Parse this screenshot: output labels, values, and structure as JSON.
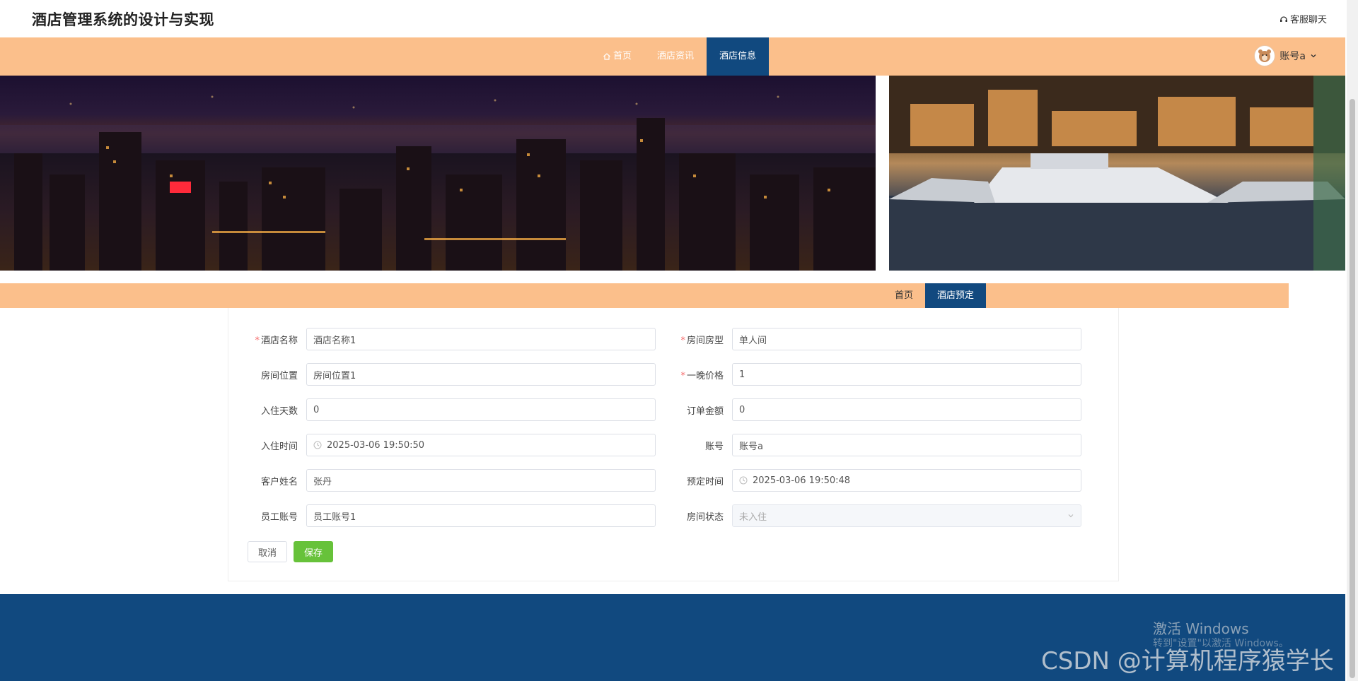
{
  "header": {
    "site_title": "酒店管理系统的设计与实现",
    "customer_service_label": "客服聊天"
  },
  "nav": {
    "items": [
      {
        "label": "首页",
        "icon": "home-icon"
      },
      {
        "label": "酒店资讯"
      },
      {
        "label": "酒店信息",
        "active": true
      }
    ],
    "user_label": "账号a"
  },
  "subnav": {
    "items": [
      {
        "label": "首页"
      },
      {
        "label": "酒店预定",
        "active": true
      }
    ]
  },
  "form": {
    "fields": [
      {
        "label": "酒店名称",
        "value": "酒店名称1",
        "required": true
      },
      {
        "label": "房间房型",
        "value": "单人间",
        "required": true
      },
      {
        "label": "房间位置",
        "value": "房间位置1",
        "required": false
      },
      {
        "label": "一晚价格",
        "value": "1",
        "required": true
      },
      {
        "label": "入住天数",
        "value": "0",
        "required": false
      },
      {
        "label": "订单金额",
        "value": "0",
        "required": false
      },
      {
        "label": "入住时间",
        "value": "2025-03-06 19:50:50",
        "required": false,
        "type": "datetime"
      },
      {
        "label": "账号",
        "value": "账号a",
        "required": false
      },
      {
        "label": "客户姓名",
        "value": "张丹",
        "required": false
      },
      {
        "label": "预定时间",
        "value": "2025-03-06 19:50:48",
        "required": false,
        "type": "datetime"
      },
      {
        "label": "员工账号",
        "value": "员工账号1",
        "required": false
      },
      {
        "label": "房间状态",
        "value": "未入住",
        "required": false,
        "type": "select"
      }
    ],
    "cancel_label": "取消",
    "save_label": "保存"
  },
  "overlay": {
    "windows_activate": "激活 Windows",
    "windows_activate_sub": "转到\"设置\"以激活 Windows。",
    "csdn_watermark": "CSDN @计算机程序猿学长"
  },
  "colors": {
    "nav_bg": "#fbbf8b",
    "nav_active": "#11497f",
    "save_green": "#67c23a",
    "required_red": "#f56c6c"
  }
}
